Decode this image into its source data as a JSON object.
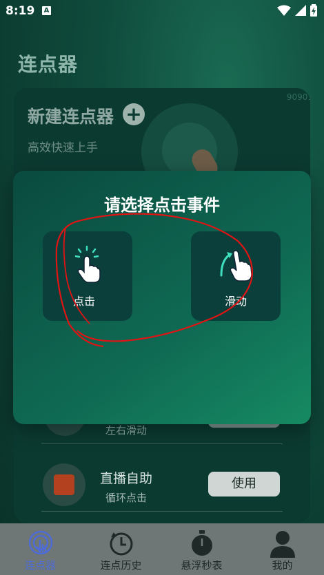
{
  "status": {
    "time": "8:19",
    "notif": "A"
  },
  "app": {
    "title": "连点器"
  },
  "card": {
    "title": "新建连点器",
    "subtitle": "高效快速上手",
    "watermark": "90901"
  },
  "rows": [
    {
      "subtitle": "左右滑动"
    },
    {
      "title": "直播自助",
      "subtitle": "循环点击",
      "button": "使用"
    }
  ],
  "dialog": {
    "title": "请选择点击事件",
    "options": [
      {
        "label": "点击",
        "icon": "tap-hand-icon"
      },
      {
        "label": "滑动",
        "icon": "swipe-hand-icon"
      }
    ]
  },
  "nav": {
    "items": [
      {
        "label": "连点器",
        "icon": "tap-hand-icon",
        "active": true
      },
      {
        "label": "连点历史",
        "icon": "history-clock-icon",
        "active": false
      },
      {
        "label": "悬浮秒表",
        "icon": "stopwatch-icon",
        "active": false
      },
      {
        "label": "我的",
        "icon": "person-icon",
        "active": false
      }
    ]
  },
  "colors": {
    "accent": "#4f6bd6",
    "annotation": "#e11414"
  }
}
